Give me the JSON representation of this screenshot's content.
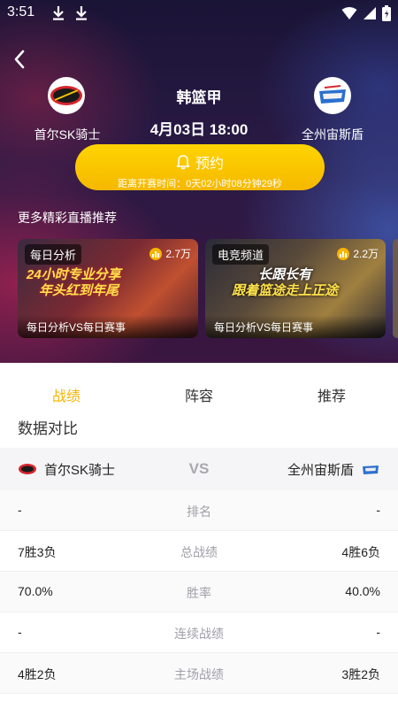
{
  "status_bar": {
    "time": "3:51"
  },
  "match": {
    "league": "韩篮甲",
    "datetime": "4月03日  18:00",
    "home": {
      "name": "首尔SK骑士",
      "logo_text": "Knights"
    },
    "away": {
      "name": "全州宙斯盾",
      "logo_text": "KCC"
    }
  },
  "reserve": {
    "label": "预约",
    "countdown": "距离开赛时间：0天02小时08分钟29秒"
  },
  "recommend": {
    "title": "更多精彩直播推荐",
    "cards": [
      {
        "tag": "每日分析",
        "views": "2.7万",
        "art_line1": "24小时专业分享",
        "art_line2": "年头红到年尾",
        "caption": "每日分析VS每日赛事"
      },
      {
        "tag": "电竞频道",
        "views": "2.2万",
        "art_line1": "长跟长有",
        "art_line2": "跟着篮途走上正途",
        "caption": "每日分析VS每日赛事"
      }
    ]
  },
  "tabs": [
    {
      "label": "战绩",
      "active": true
    },
    {
      "label": "阵容",
      "active": false
    },
    {
      "label": "推荐",
      "active": false
    }
  ],
  "compare": {
    "title": "数据对比",
    "vs": "VS",
    "home_name": "首尔SK骑士",
    "away_name": "全州宙斯盾",
    "rows": [
      {
        "label": "排名",
        "home": "-",
        "away": "-"
      },
      {
        "label": "总战绩",
        "home": "7胜3负",
        "away": "4胜6负"
      },
      {
        "label": "胜率",
        "home": "70.0%",
        "away": "40.0%"
      },
      {
        "label": "连续战绩",
        "home": "-",
        "away": "-"
      },
      {
        "label": "主场战绩",
        "home": "4胜2负",
        "away": "3胜2负"
      }
    ]
  },
  "colors": {
    "accent": "#f5b400",
    "home_logo": "#d6262d",
    "away_logo": "#2c6fd0"
  }
}
